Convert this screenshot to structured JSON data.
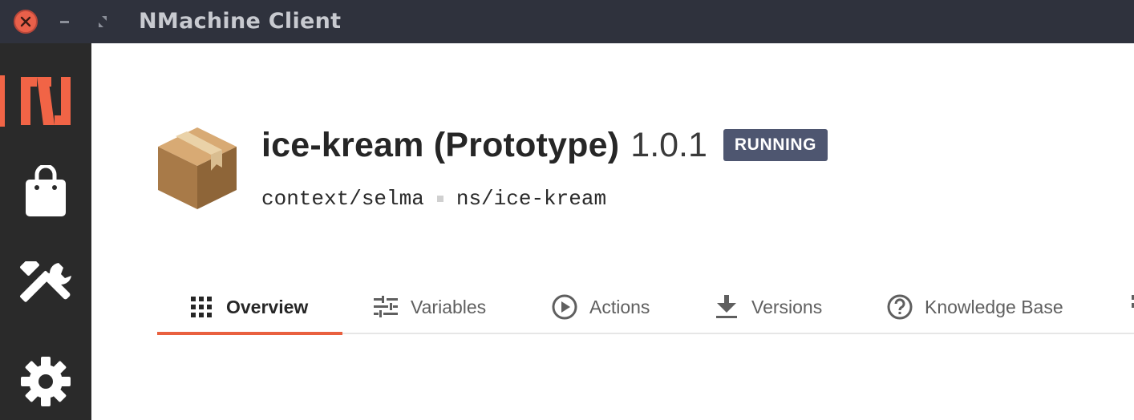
{
  "window": {
    "title": "NMachine Client",
    "icons": {
      "close": "close-icon",
      "minimize": "minimize-icon",
      "maximize": "maximize-icon"
    }
  },
  "sidebar": {
    "items": [
      {
        "name": "nmachine-logo",
        "icon": "nmachine-logo-icon",
        "active": true
      },
      {
        "name": "store",
        "icon": "shopping-bag-icon"
      },
      {
        "name": "tools",
        "icon": "tools-icon"
      },
      {
        "name": "settings",
        "icon": "gear-icon"
      }
    ]
  },
  "app": {
    "icon": "package-box-icon",
    "name": "ice-kream (Prototype)",
    "version": "1.0.1",
    "status": "RUNNING",
    "context": "context/selma",
    "namespace": "ns/ice-kream"
  },
  "tabs": [
    {
      "label": "Overview",
      "icon": "grid-icon",
      "active": true
    },
    {
      "label": "Variables",
      "icon": "sliders-icon"
    },
    {
      "label": "Actions",
      "icon": "play-circle-icon"
    },
    {
      "label": "Versions",
      "icon": "download-icon"
    },
    {
      "label": "Knowledge Base",
      "icon": "help-circle-icon"
    }
  ],
  "colors": {
    "titlebar": "#2f323d",
    "sidebar": "#2a2a2a",
    "accent": "#f16446",
    "status_badge": "#4e5670",
    "active_tab_underline": "#e9603f"
  }
}
